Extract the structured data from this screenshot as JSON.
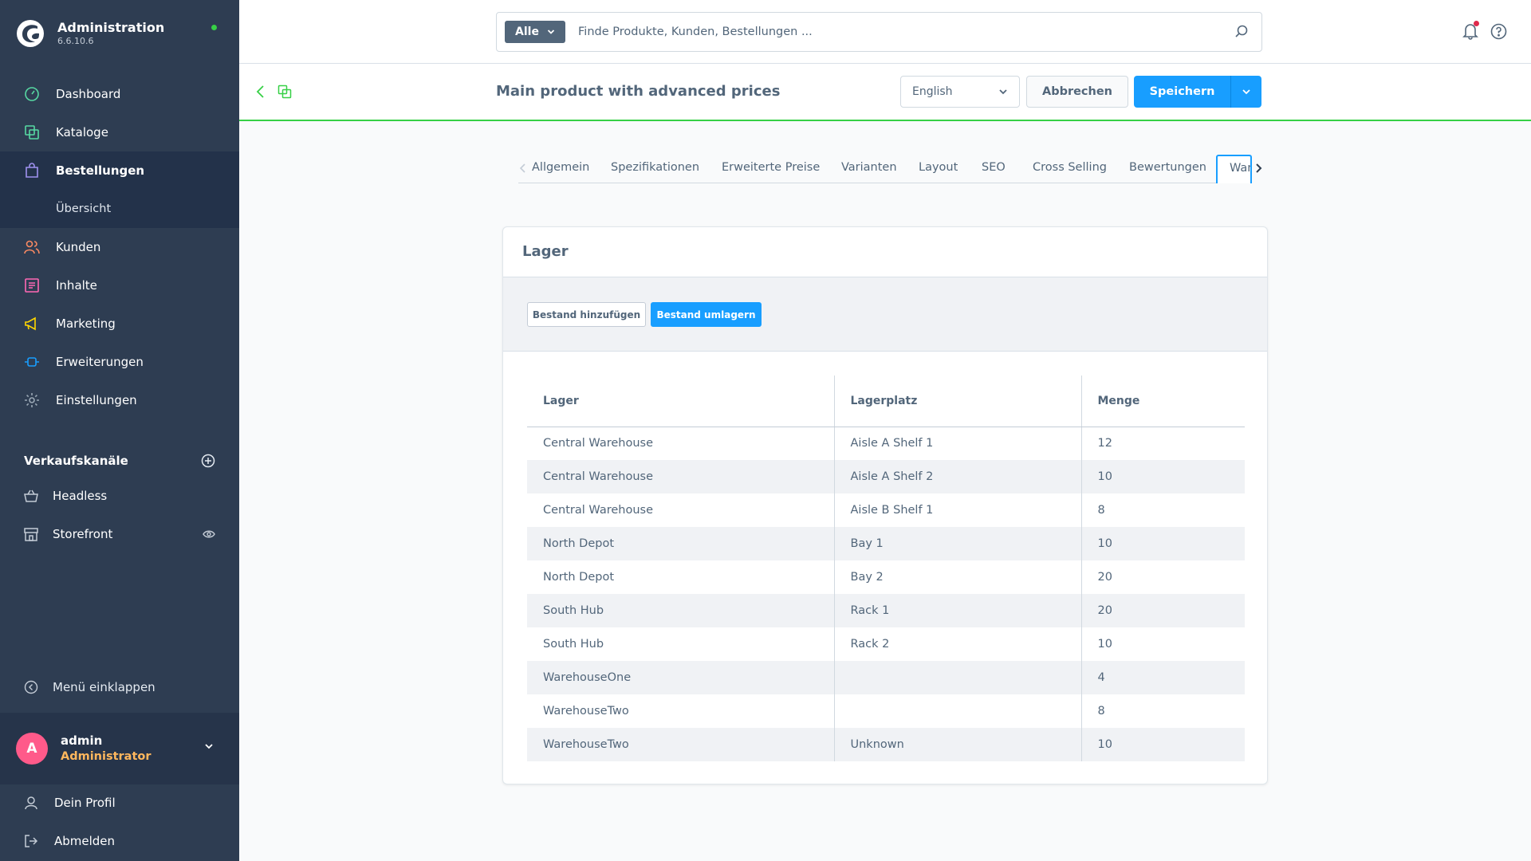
{
  "app": {
    "title": "Administration",
    "version": "6.6.10.6",
    "status_color": "#37d046",
    "accent": "#189eff",
    "sidebar_bg": "#2e3d52"
  },
  "sidebar": {
    "items": [
      {
        "label": "Dashboard",
        "icon": "dashboard-gauge-icon",
        "icon_color": "#57d9a3"
      },
      {
        "label": "Kataloge",
        "icon": "catalog-icon",
        "icon_color": "#57d9a3"
      },
      {
        "label": "Bestellungen",
        "icon": "shopping-bag-icon",
        "icon_color": "#a092f0",
        "active": true
      },
      {
        "label": "Übersicht",
        "sub": true
      },
      {
        "label": "Kunden",
        "icon": "customers-icon",
        "icon_color": "#f88962"
      },
      {
        "label": "Inhalte",
        "icon": "content-list-icon",
        "icon_color": "#ff68b4"
      },
      {
        "label": "Marketing",
        "icon": "megaphone-icon",
        "icon_color": "#ffd700"
      },
      {
        "label": "Erweiterungen",
        "icon": "plug-icon",
        "icon_color": "#189eff"
      },
      {
        "label": "Einstellungen",
        "icon": "gear-icon",
        "icon_color": "#9aa8b5"
      }
    ],
    "sales_channels_title": "Verkaufskanäle",
    "sales_channels": [
      {
        "label": "Headless",
        "icon": "basket-icon"
      },
      {
        "label": "Storefront",
        "icon": "storefront-icon"
      }
    ],
    "collapse_label": "Menü einklappen",
    "user": {
      "initial": "A",
      "name": "admin",
      "role": "Administrator"
    },
    "profile_label": "Dein Profil",
    "logout_label": "Abmelden"
  },
  "search": {
    "type_label": "Alle",
    "placeholder": "Finde Produkte, Kunden, Bestellungen ..."
  },
  "smartbar": {
    "title": "Main product with advanced prices",
    "language": "English",
    "cancel_label": "Abbrechen",
    "save_label": "Speichern"
  },
  "tabs": [
    "Allgemein",
    "Spezifikationen",
    "Erweiterte Preise",
    "Varianten",
    "Layout",
    "SEO",
    "Cross Selling",
    "Bewertungen"
  ],
  "active_tab_label": "Warehouse",
  "card": {
    "title": "Lager",
    "add_stock_label": "Bestand hinzufügen",
    "move_stock_label": "Bestand umlagern"
  },
  "table": {
    "headers": [
      "Lager",
      "Lagerplatz",
      "Menge"
    ],
    "rows": [
      [
        "Central Warehouse",
        "Aisle A Shelf 1",
        "12"
      ],
      [
        "Central Warehouse",
        "Aisle A Shelf 2",
        "10"
      ],
      [
        "Central Warehouse",
        "Aisle B Shelf 1",
        "8"
      ],
      [
        "North Depot",
        "Bay 1",
        "10"
      ],
      [
        "North Depot",
        "Bay 2",
        "20"
      ],
      [
        "South Hub",
        "Rack 1",
        "20"
      ],
      [
        "South Hub",
        "Rack 2",
        "10"
      ],
      [
        "WarehouseOne",
        "",
        "4"
      ],
      [
        "WarehouseTwo",
        "",
        "8"
      ],
      [
        "WarehouseTwo",
        "Unknown",
        "10"
      ]
    ]
  }
}
